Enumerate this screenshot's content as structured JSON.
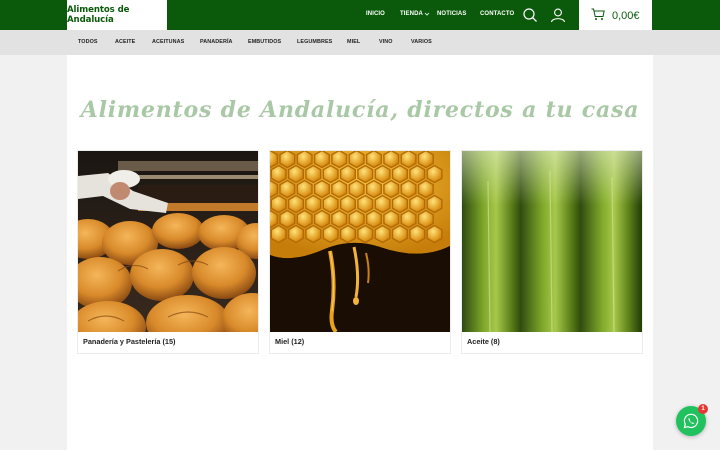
{
  "header": {
    "logo_text": "Alimentos de Andalucía",
    "nav": [
      {
        "label": "INICIO"
      },
      {
        "label": "TIENDA"
      },
      {
        "label": "NOTICIAS"
      },
      {
        "label": "CONTACTO"
      }
    ],
    "cart_total": "0,00€",
    "icons": {
      "search": "search-icon",
      "account": "user-icon",
      "cart": "cart-icon",
      "tienda_dropdown": "chevron-down-icon"
    }
  },
  "categories": [
    "TODOS",
    "ACEITE",
    "ACEITUNAS",
    "PANADERÍA",
    "EMBUTIDOS",
    "LEGUMBRES",
    "MIEL",
    "VINO",
    "VARIOS"
  ],
  "hero": {
    "title": "Alimentos de Andalucía, directos a tu casa"
  },
  "cards": [
    {
      "label": "Panadería y Pastelería (15)",
      "image": "bread-photo"
    },
    {
      "label": "Miel (12)",
      "image": "honeycomb-photo"
    },
    {
      "label": "Aceite (8)",
      "image": "olive-oil-bottles-photo"
    }
  ],
  "whatsapp": {
    "badge": "1",
    "icon": "whatsapp-icon"
  },
  "colors": {
    "brand_green": "#0b5a0b",
    "hero_text": "#a9c8a5",
    "whatsapp_green": "#21c15e",
    "badge_red": "#e53935"
  }
}
